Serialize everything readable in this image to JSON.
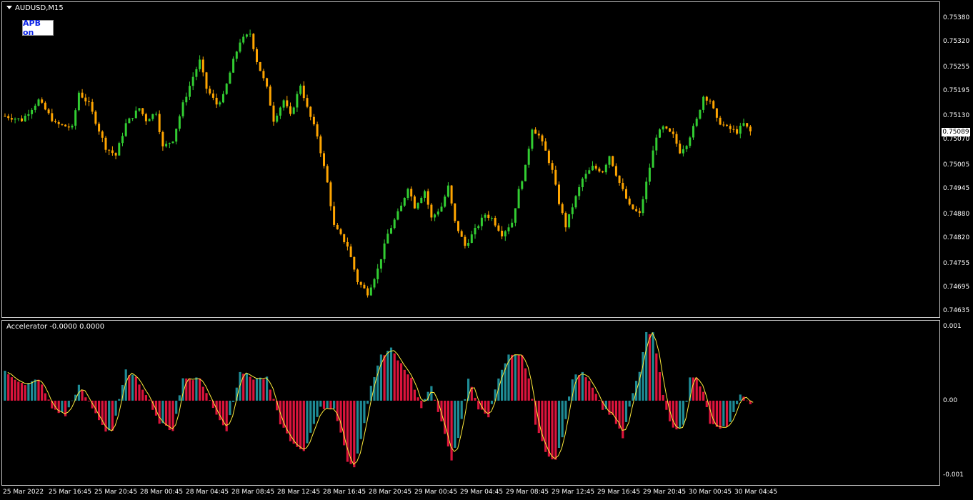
{
  "chart": {
    "symbol_label": "AUDUSD,M15",
    "apb_button_label": "APB on",
    "current_price": "0.75089",
    "bull_color": "#32cd32",
    "bear_color": "#ffa500"
  },
  "price_axis": [
    "0.75380",
    "0.75320",
    "0.75255",
    "0.75195",
    "0.75130",
    "0.75070",
    "0.75005",
    "0.74945",
    "0.74880",
    "0.74820",
    "0.74755",
    "0.74695",
    "0.74635"
  ],
  "indicator": {
    "title": "Accelerator -0.0000 0.0000",
    "axis": [
      "0.001",
      "0.00",
      "-0.001"
    ],
    "up_color": "#1e8c96",
    "down_color": "#dc143c",
    "signal_color": "#ffeb3b"
  },
  "time_axis": [
    "25 Mar 2022",
    "25 Mar 16:45",
    "25 Mar 20:45",
    "28 Mar 00:45",
    "28 Mar 04:45",
    "28 Mar 08:45",
    "28 Mar 12:45",
    "28 Mar 16:45",
    "28 Mar 20:45",
    "29 Mar 00:45",
    "29 Mar 04:45",
    "29 Mar 08:45",
    "29 Mar 12:45",
    "29 Mar 16:45",
    "29 Mar 20:45",
    "30 Mar 00:45",
    "30 Mar 04:45"
  ],
  "chart_data": {
    "type": "candlestick",
    "symbol": "AUDUSD",
    "timeframe": "M15",
    "close_path": [
      [
        0,
        0.7513
      ],
      [
        5,
        0.7512
      ],
      [
        10,
        0.7517
      ],
      [
        15,
        0.7511
      ],
      [
        20,
        0.751
      ],
      [
        22,
        0.7519
      ],
      [
        25,
        0.7516
      ],
      [
        30,
        0.7505
      ],
      [
        33,
        0.7503
      ],
      [
        36,
        0.7511
      ],
      [
        40,
        0.7515
      ],
      [
        42,
        0.7512
      ],
      [
        45,
        0.7514
      ],
      [
        47,
        0.7505
      ],
      [
        50,
        0.7507
      ],
      [
        53,
        0.7516
      ],
      [
        56,
        0.7523
      ],
      [
        58,
        0.7527
      ],
      [
        60,
        0.752
      ],
      [
        63,
        0.7516
      ],
      [
        65,
        0.7518
      ],
      [
        68,
        0.7527
      ],
      [
        70,
        0.7532
      ],
      [
        73,
        0.7534
      ],
      [
        75,
        0.7527
      ],
      [
        78,
        0.752
      ],
      [
        80,
        0.7512
      ],
      [
        83,
        0.7517
      ],
      [
        85,
        0.7513
      ],
      [
        88,
        0.7521
      ],
      [
        90,
        0.7515
      ],
      [
        93,
        0.7508
      ],
      [
        96,
        0.7496
      ],
      [
        98,
        0.7485
      ],
      [
        102,
        0.748
      ],
      [
        105,
        0.7471
      ],
      [
        108,
        0.7468
      ],
      [
        111,
        0.7474
      ],
      [
        114,
        0.7483
      ],
      [
        118,
        0.749
      ],
      [
        120,
        0.7495
      ],
      [
        122,
        0.749
      ],
      [
        125,
        0.7494
      ],
      [
        127,
        0.7487
      ],
      [
        130,
        0.749
      ],
      [
        132,
        0.7495
      ],
      [
        134,
        0.7486
      ],
      [
        137,
        0.748
      ],
      [
        140,
        0.7484
      ],
      [
        143,
        0.7488
      ],
      [
        145,
        0.7487
      ],
      [
        148,
        0.7483
      ],
      [
        151,
        0.7486
      ],
      [
        153,
        0.7494
      ],
      [
        155,
        0.75
      ],
      [
        157,
        0.751
      ],
      [
        159,
        0.7508
      ],
      [
        161,
        0.7504
      ],
      [
        163,
        0.7499
      ],
      [
        165,
        0.7491
      ],
      [
        167,
        0.7485
      ],
      [
        169,
        0.749
      ],
      [
        172,
        0.7497
      ],
      [
        175,
        0.75
      ],
      [
        178,
        0.7499
      ],
      [
        180,
        0.7503
      ],
      [
        183,
        0.7496
      ],
      [
        186,
        0.749
      ],
      [
        189,
        0.7488
      ],
      [
        191,
        0.7496
      ],
      [
        194,
        0.7508
      ],
      [
        196,
        0.751
      ],
      [
        199,
        0.7508
      ],
      [
        201,
        0.7504
      ],
      [
        203,
        0.7506
      ],
      [
        206,
        0.7512
      ],
      [
        208,
        0.7518
      ],
      [
        210,
        0.7517
      ],
      [
        212,
        0.7512
      ],
      [
        215,
        0.751
      ],
      [
        218,
        0.7509
      ],
      [
        220,
        0.7511
      ],
      [
        222,
        0.7509
      ]
    ],
    "last_close": 0.75089,
    "y_range": [
      0.74635,
      0.75405
    ]
  },
  "indicator_data": {
    "type": "histogram",
    "name": "Accelerator",
    "values": [
      [
        0,
        0.0004
      ],
      [
        6,
        0.0002
      ],
      [
        10,
        0.0003
      ],
      [
        14,
        -0.0001
      ],
      [
        18,
        -0.0002
      ],
      [
        22,
        0.0002
      ],
      [
        26,
        -0.0001
      ],
      [
        30,
        -0.0004
      ],
      [
        32,
        -0.0004
      ],
      [
        36,
        0.0004
      ],
      [
        39,
        0.0003
      ],
      [
        42,
        0.0001
      ],
      [
        46,
        -0.0003
      ],
      [
        50,
        -0.0004
      ],
      [
        53,
        0.0003
      ],
      [
        58,
        0.0003
      ],
      [
        62,
        -0.0001
      ],
      [
        66,
        -0.0004
      ],
      [
        70,
        0.0004
      ],
      [
        74,
        0.0003
      ],
      [
        78,
        0.0003
      ],
      [
        82,
        -0.0003
      ],
      [
        86,
        -0.0006
      ],
      [
        89,
        -0.0007
      ],
      [
        92,
        -0.0003
      ],
      [
        94,
        -0.0001
      ],
      [
        98,
        -0.0001
      ],
      [
        102,
        -0.0008
      ],
      [
        104,
        -0.0009
      ],
      [
        107,
        -0.0003
      ],
      [
        109,
        0.0002
      ],
      [
        112,
        0.0006
      ],
      [
        115,
        0.0007
      ],
      [
        118,
        0.0005
      ],
      [
        121,
        0.0003
      ],
      [
        124,
        -0.0001
      ],
      [
        127,
        0.0002
      ],
      [
        130,
        -0.0003
      ],
      [
        133,
        -0.0008
      ],
      [
        135,
        -0.0005
      ],
      [
        138,
        0.0003
      ],
      [
        141,
        -0.0001
      ],
      [
        144,
        -0.0002
      ],
      [
        147,
        0.0003
      ],
      [
        150,
        0.0006
      ],
      [
        154,
        0.0006
      ],
      [
        156,
        0.0003
      ],
      [
        158,
        -0.0003
      ],
      [
        161,
        -0.0007
      ],
      [
        164,
        -0.0008
      ],
      [
        166,
        -0.0005
      ],
      [
        169,
        0.0003
      ],
      [
        172,
        0.0004
      ],
      [
        175,
        0.0002
      ],
      [
        178,
        -0.0001
      ],
      [
        181,
        -0.0002
      ],
      [
        184,
        -0.0005
      ],
      [
        187,
        0.0001
      ],
      [
        189,
        0.0004
      ],
      [
        191,
        0.0009
      ],
      [
        193,
        0.0009
      ],
      [
        196,
        0.0001
      ],
      [
        198,
        -0.0003
      ],
      [
        200,
        -0.0004
      ],
      [
        202,
        -0.0003
      ],
      [
        204,
        0.0003
      ],
      [
        206,
        0.0003
      ],
      [
        208,
        0.0001
      ],
      [
        210,
        -0.0003
      ],
      [
        213,
        -0.0004
      ],
      [
        216,
        -0.0003
      ],
      [
        219,
        0.0001
      ],
      [
        222,
        -5e-05
      ]
    ],
    "y_range": [
      -0.00106,
      0.00103
    ]
  }
}
